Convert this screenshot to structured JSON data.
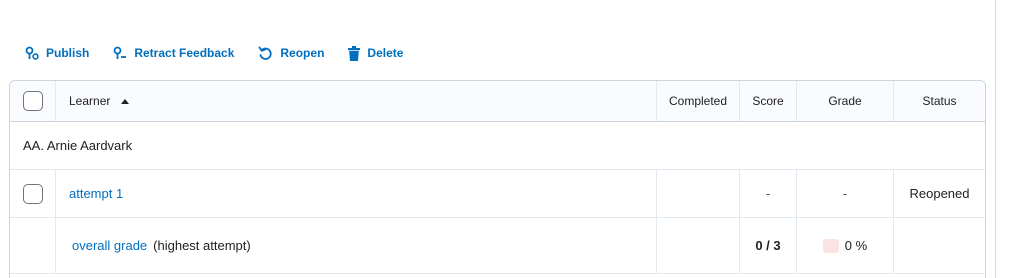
{
  "toolbar": {
    "publish": "Publish",
    "retract": "Retract Feedback",
    "reopen": "Reopen",
    "delete": "Delete",
    "accent": "#006fbf"
  },
  "table": {
    "headers": {
      "learner": "Learner",
      "completed": "Completed",
      "score": "Score",
      "grade": "Grade",
      "status": "Status"
    },
    "sort": "ascending",
    "group": "AA. Arnie Aardvark",
    "attempt": {
      "label": "attempt 1",
      "completed": "",
      "score": "-",
      "grade": "-",
      "status": "Reopened"
    },
    "overall": {
      "label": "overall grade",
      "note": "(highest attempt)",
      "score": "0 / 3",
      "grade": "0 %"
    }
  }
}
